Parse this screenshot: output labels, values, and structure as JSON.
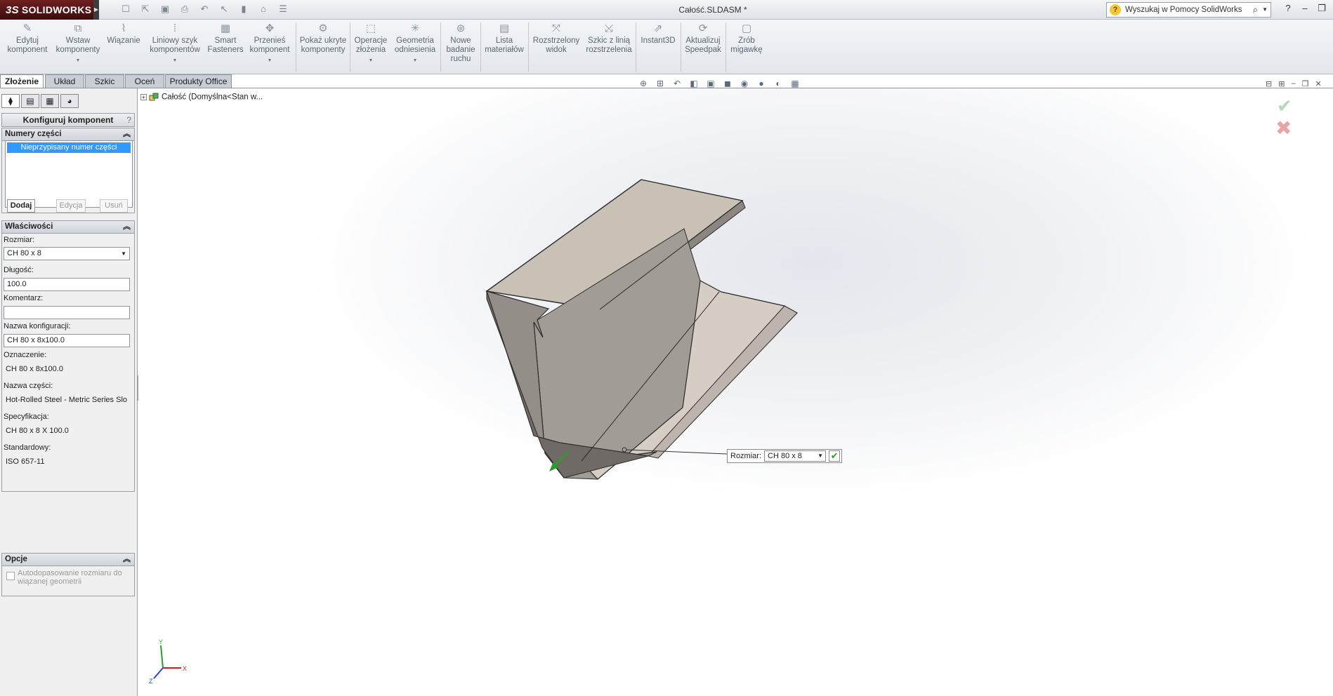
{
  "app": {
    "name": "SOLIDWORKS",
    "ds_mark": "3S",
    "document_title": "Całość.SLDASM *"
  },
  "search": {
    "placeholder": "Wyszukaj w Pomocy SolidWorks"
  },
  "ribbon": {
    "buttons": [
      {
        "label": "Edytuj\nkomponent"
      },
      {
        "label": "Wstaw\nkomponenty"
      },
      {
        "label": "Wiązanie"
      },
      {
        "label": "Liniowy szyk\nkomponentów"
      },
      {
        "label": "Smart\nFasteners"
      },
      {
        "label": "Przenieś\nkomponent"
      },
      {
        "label": "Pokaż ukryte\nkomponenty"
      },
      {
        "label": "Operacje\nzłożenia"
      },
      {
        "label": "Geometria\nodniesienia"
      },
      {
        "label": "Nowe\nbadanie\nruchu"
      },
      {
        "label": "Lista\nmateriałów"
      },
      {
        "label": "Rozstrzelony\nwidok"
      },
      {
        "label": "Szkic z linią\nrozstrzelenia"
      },
      {
        "label": "Instant3D"
      },
      {
        "label": "Aktualizuj\nSpeedpak"
      },
      {
        "label": "Zrób\nmigawkę"
      }
    ]
  },
  "tabs": [
    "Złożenie",
    "Układ",
    "Szkic",
    "Oceń",
    "Produkty Office"
  ],
  "property_manager": {
    "title": "Konfiguruj komponent",
    "help": "?",
    "part_numbers": {
      "header": "Numery części",
      "items": [
        "Nieprzypisany numer części"
      ],
      "add": "Dodaj",
      "edit": "Edycja",
      "remove": "Usuń"
    },
    "properties": {
      "header": "Właściwości",
      "size_label": "Rozmiar:",
      "size_value": "CH 80 x 8",
      "length_label": "Długość:",
      "length_value": "100.0",
      "comment_label": "Komentarz:",
      "comment_value": "",
      "config_label": "Nazwa konfiguracji:",
      "config_value": "CH 80 x 8x100.0",
      "designation_label": "Oznaczenie:",
      "designation_value": "CH 80 x 8x100.0",
      "part_name_label": "Nazwa części:",
      "part_name_value": "Hot-Rolled Steel - Metric Series Slo",
      "spec_label": "Specyfikacja:",
      "spec_value": "CH 80 x 8 X 100.0",
      "standard_label": "Standardowy:",
      "standard_value": "ISO 657-11"
    },
    "options": {
      "header": "Opcje",
      "auto_fit_label": "Autodopasowanie rozmiaru do wiązanej geometrii"
    }
  },
  "tree": {
    "root": "Całość  (Domyślna<Stan w..."
  },
  "callout": {
    "label": "Rozmiar:",
    "value": "CH 80 x 8"
  },
  "colors": {
    "accent": "#3399ff",
    "ok": "#2e9a2e",
    "cancel": "#c22222",
    "part_face": "#cbc4bc"
  }
}
